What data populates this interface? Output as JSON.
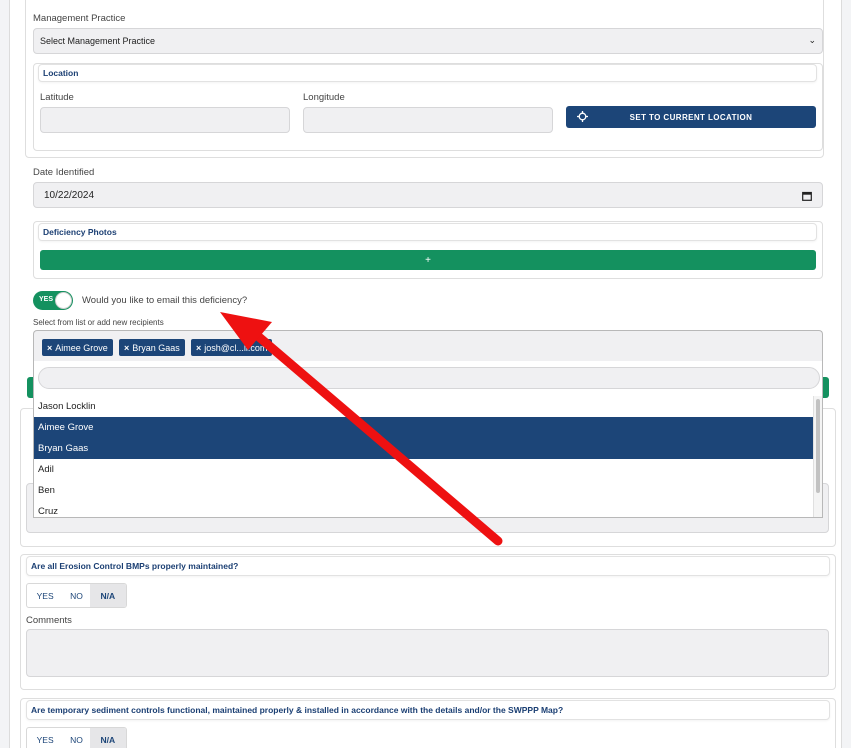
{
  "form": {
    "management_practice_label": "Management Practice",
    "management_practice_value": "Select Management Practice",
    "location": {
      "header": "Location",
      "latitude_label": "Latitude",
      "longitude_label": "Longitude",
      "set_location_button": "SET TO CURRENT LOCATION"
    },
    "date_identified_label": "Date Identified",
    "date_identified_value": "10/22/2024",
    "deficiency_photos": {
      "header": "Deficiency Photos",
      "add_button": "+"
    },
    "email_toggle": {
      "state_label": "YES",
      "question": "Would you like to email this deficiency?"
    },
    "recipients": {
      "label": "Select from list or add new recipients",
      "tags": [
        "Aimee Grove",
        "Bryan Gaas",
        "josh@cl...li.com"
      ],
      "tag_remove_glyph": "×",
      "dropdown_options": [
        {
          "label": "Jason Locklin",
          "selected": false
        },
        {
          "label": "Aimee Grove",
          "selected": true
        },
        {
          "label": "Bryan Gaas",
          "selected": true
        },
        {
          "label": "Adil",
          "selected": false
        },
        {
          "label": "Ben",
          "selected": false
        },
        {
          "label": "Cruz",
          "selected": false
        }
      ]
    }
  },
  "questions": [
    {
      "text": "Are all Erosion Control BMPs properly maintained?",
      "options": [
        "YES",
        "NO",
        "N/A"
      ],
      "selected": "N/A",
      "comments_label": "Comments"
    },
    {
      "text": "Are temporary sediment controls functional, maintained properly & installed in accordance with the details and/or the SWPPP Map?",
      "options": [
        "YES",
        "NO",
        "N/A"
      ],
      "selected": "N/A"
    }
  ],
  "colors": {
    "primary_blue": "#1c4578",
    "green": "#14915f",
    "annotation_arrow": "#ee1111"
  }
}
